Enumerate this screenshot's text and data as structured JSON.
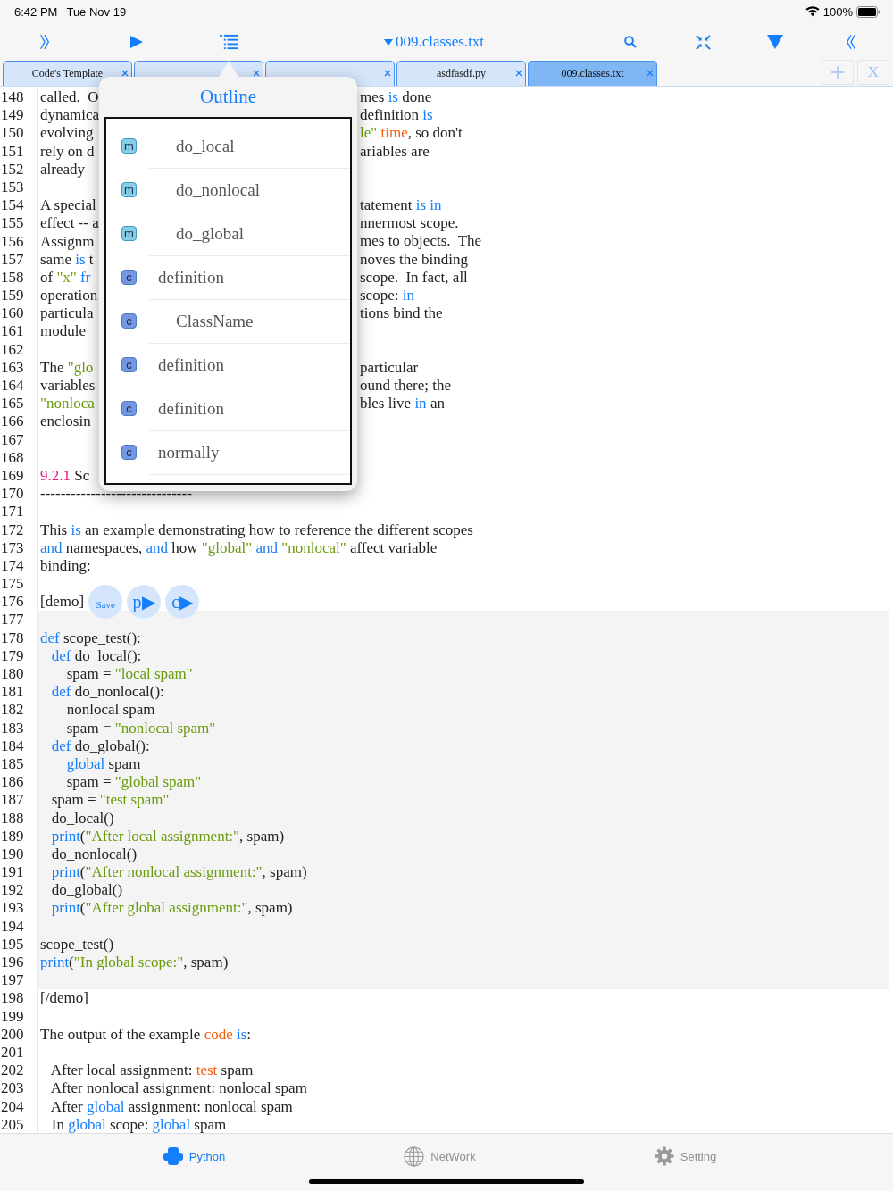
{
  "status_bar": {
    "time": "6:42 PM",
    "date": "Tue Nov 19",
    "battery": "100%"
  },
  "toolbar": {
    "title": "009.classes.txt"
  },
  "file_tabs": [
    {
      "label": "Code's Template",
      "selected": false
    },
    {
      "selected": false
    },
    {
      "selected": false
    },
    {
      "label": "asdfasdf.py",
      "selected": false
    },
    {
      "label": "009.classes.txt",
      "selected": true
    }
  ],
  "tab_actions": {
    "close_all": "X"
  },
  "editor": {
    "lines": [
      {
        "number": "148",
        "kind": "text",
        "text": [
          "called.  O"
        ],
        "right": [
          "mes ",
          {
            "kind": "keyword",
            "text": "is"
          },
          " done"
        ]
      },
      {
        "number": "149",
        "kind": "text",
        "text": [
          "dynamica"
        ],
        "right": [
          "definition ",
          {
            "kind": "keyword",
            "text": "is"
          }
        ]
      },
      {
        "number": "150",
        "kind": "text",
        "text": [
          "evolving"
        ],
        "right": [
          {
            "kind": "string",
            "text": "le\" "
          },
          {
            "kind": "accent",
            "text": "time"
          },
          ", so don't"
        ]
      },
      {
        "number": "151",
        "kind": "text",
        "text": [
          "rely on d"
        ],
        "right": [
          "ariables are"
        ]
      },
      {
        "number": "152",
        "kind": "text",
        "text": [
          "already"
        ]
      },
      {
        "number": "153",
        "kind": "text"
      },
      {
        "number": "154",
        "kind": "text",
        "text": [
          "A special"
        ],
        "right": [
          "tatement ",
          {
            "kind": "keyword",
            "text": "is in"
          }
        ]
      },
      {
        "number": "155",
        "kind": "text",
        "text": [
          "effect -- a"
        ],
        "right": [
          "nnermost scope."
        ]
      },
      {
        "number": "156",
        "kind": "text",
        "text": [
          "Assignm"
        ],
        "right": [
          "mes to objects.  The"
        ]
      },
      {
        "number": "157",
        "kind": "text",
        "text": [
          "same ",
          {
            "kind": "keyword",
            "text": "is"
          },
          " t"
        ],
        "right": [
          "noves the binding"
        ]
      },
      {
        "number": "158",
        "kind": "text",
        "text": [
          "of ",
          {
            "kind": "string",
            "text": "\"x\" "
          },
          {
            "kind": "keyword",
            "text": "fr"
          }
        ],
        "right": [
          "scope.  In fact, all"
        ]
      },
      {
        "number": "159",
        "kind": "text",
        "text": [
          "operation"
        ],
        "right": [
          "scope: ",
          {
            "kind": "keyword",
            "text": "in"
          }
        ]
      },
      {
        "number": "160",
        "kind": "text",
        "text": [
          "particula"
        ],
        "right": [
          "tions bind the"
        ]
      },
      {
        "number": "161",
        "kind": "text",
        "text": [
          "module"
        ]
      },
      {
        "number": "162",
        "kind": "text"
      },
      {
        "number": "163",
        "kind": "text",
        "text": [
          "The ",
          {
            "kind": "string",
            "text": "\"glo"
          }
        ],
        "right": [
          "particular"
        ]
      },
      {
        "number": "164",
        "kind": "text",
        "text": [
          "variables"
        ],
        "right": [
          "ound there; the"
        ]
      },
      {
        "number": "165",
        "kind": "text",
        "text": [
          {
            "kind": "string",
            "text": "\"nonloca"
          }
        ],
        "right": [
          "bles live ",
          {
            "kind": "keyword",
            "text": "in"
          },
          " an"
        ]
      },
      {
        "number": "166",
        "kind": "text",
        "text": [
          "enclosin"
        ]
      },
      {
        "number": "167",
        "kind": "text"
      },
      {
        "number": "168",
        "kind": "text"
      },
      {
        "number": "169",
        "kind": "text",
        "text": [
          {
            "kind": "heading",
            "text": "9.2.1"
          },
          " Sc"
        ]
      },
      {
        "number": "170",
        "kind": "text",
        "text": [
          "------------------------------"
        ]
      },
      {
        "number": "171",
        "kind": "text"
      },
      {
        "number": "172",
        "kind": "text",
        "text": [
          "This ",
          {
            "kind": "keyword",
            "text": "is"
          },
          " an example demonstrating how to reference the different scopes"
        ]
      },
      {
        "number": "173",
        "kind": "text",
        "text": [
          {
            "kind": "keyword",
            "text": "and"
          },
          " namespaces, ",
          {
            "kind": "keyword",
            "text": "and"
          },
          " how ",
          {
            "kind": "string",
            "text": "\"global\" "
          },
          {
            "kind": "keyword",
            "text": "and"
          },
          {
            "kind": "string",
            "text": " \"nonlocal\""
          },
          " affect variable"
        ]
      },
      {
        "number": "174",
        "kind": "text",
        "text": [
          "binding:"
        ]
      },
      {
        "number": "175",
        "kind": "text"
      },
      {
        "number": "176",
        "kind": "demo",
        "text": [
          "[demo]"
        ],
        "buttons": [
          {
            "label": "Save",
            "kind": "save"
          },
          {
            "label": "p▶",
            "kind": "run"
          },
          {
            "label": "c▶",
            "kind": "run"
          }
        ]
      },
      {
        "number": "177",
        "kind": "code"
      },
      {
        "number": "178",
        "kind": "code",
        "text": [
          {
            "kind": "keyword",
            "text": "def"
          },
          " scope_test():"
        ]
      },
      {
        "number": "179",
        "kind": "code",
        "text": [
          {
            "kind": "keyword",
            "text": "   def"
          },
          " do_local():"
        ]
      },
      {
        "number": "180",
        "kind": "code",
        "text": [
          "       spam = ",
          {
            "kind": "string",
            "text": "\"local spam\""
          }
        ]
      },
      {
        "number": "181",
        "kind": "code",
        "text": [
          {
            "kind": "keyword",
            "text": "   def"
          },
          " do_nonlocal():"
        ]
      },
      {
        "number": "182",
        "kind": "code",
        "text": [
          "       nonlocal spam"
        ]
      },
      {
        "number": "183",
        "kind": "code",
        "text": [
          "       spam = ",
          {
            "kind": "string",
            "text": "\"nonlocal spam\""
          }
        ]
      },
      {
        "number": "184",
        "kind": "code",
        "text": [
          {
            "kind": "keyword",
            "text": "   def"
          },
          " do_global():"
        ]
      },
      {
        "number": "185",
        "kind": "code",
        "text": [
          {
            "kind": "keyword",
            "text": "       global"
          },
          " spam"
        ]
      },
      {
        "number": "186",
        "kind": "code",
        "text": [
          "       spam = ",
          {
            "kind": "string",
            "text": "\"global spam\""
          }
        ]
      },
      {
        "number": "187",
        "kind": "code",
        "text": [
          "   spam = ",
          {
            "kind": "string",
            "text": "\"test spam\""
          }
        ]
      },
      {
        "number": "188",
        "kind": "code",
        "text": [
          "   do_local()"
        ]
      },
      {
        "number": "189",
        "kind": "code",
        "text": [
          {
            "kind": "keyword",
            "text": "   print"
          },
          "(",
          {
            "kind": "string",
            "text": "\"After local assignment:\""
          },
          ", spam)"
        ]
      },
      {
        "number": "190",
        "kind": "code",
        "text": [
          "   do_nonlocal()"
        ]
      },
      {
        "number": "191",
        "kind": "code",
        "text": [
          {
            "kind": "keyword",
            "text": "   print"
          },
          "(",
          {
            "kind": "string",
            "text": "\"After nonlocal assignment:\""
          },
          ", spam)"
        ]
      },
      {
        "number": "192",
        "kind": "code",
        "text": [
          "   do_global()"
        ]
      },
      {
        "number": "193",
        "kind": "code",
        "text": [
          {
            "kind": "keyword",
            "text": "   print"
          },
          "(",
          {
            "kind": "string",
            "text": "\"After global assignment:\""
          },
          ", spam)"
        ]
      },
      {
        "number": "194",
        "kind": "code"
      },
      {
        "number": "195",
        "kind": "code",
        "text": [
          "scope_test()"
        ]
      },
      {
        "number": "196",
        "kind": "code",
        "text": [
          {
            "kind": "keyword",
            "text": "print"
          },
          "(",
          {
            "kind": "string",
            "text": "\"In global scope:\""
          },
          ", spam)"
        ]
      },
      {
        "number": "197",
        "kind": "code"
      },
      {
        "number": "198",
        "kind": "text",
        "text": [
          "[/demo]"
        ]
      },
      {
        "number": "199",
        "kind": "text"
      },
      {
        "number": "200",
        "kind": "text",
        "text": [
          "The output of the example ",
          {
            "kind": "accent",
            "text": "code "
          },
          {
            "kind": "keyword",
            "text": "is"
          },
          ":"
        ]
      },
      {
        "number": "201",
        "kind": "text"
      },
      {
        "number": "202",
        "kind": "text",
        "text": [
          "   After local assignment: ",
          {
            "kind": "accent",
            "text": "test"
          },
          " spam"
        ]
      },
      {
        "number": "203",
        "kind": "text",
        "text": [
          "   After nonlocal assignment: nonlocal spam"
        ]
      },
      {
        "number": "204",
        "kind": "text",
        "text": [
          "   After ",
          {
            "kind": "keyword",
            "text": "global"
          },
          " assignment: nonlocal spam"
        ]
      },
      {
        "number": "205",
        "kind": "text",
        "text": [
          "   In ",
          {
            "kind": "keyword",
            "text": "global"
          },
          " scope: ",
          {
            "kind": "keyword",
            "text": "global"
          },
          " spam"
        ]
      }
    ]
  },
  "outline": {
    "title": "Outline",
    "nested_items": [
      {
        "badge": "m",
        "kind": "method",
        "label": "do_local"
      },
      {
        "badge": "m",
        "kind": "method",
        "label": "do_nonlocal"
      },
      {
        "badge": "m",
        "kind": "method",
        "label": "do_global"
      }
    ],
    "items": [
      {
        "badge": "c",
        "kind": "class",
        "label": "definition",
        "children": [
          {
            "badge": "c",
            "kind": "class",
            "label": "ClassName"
          }
        ]
      },
      {
        "badge": "c",
        "kind": "class",
        "label": "definition"
      },
      {
        "badge": "c",
        "kind": "class",
        "label": "definition"
      },
      {
        "badge": "c",
        "kind": "class",
        "label": "normally"
      }
    ]
  },
  "bottom_tabs": [
    {
      "label": "Python",
      "kind": "python",
      "selected": true
    },
    {
      "label": "NetWork",
      "kind": "network",
      "selected": false
    },
    {
      "label": "Setting",
      "kind": "settings",
      "selected": false
    }
  ]
}
